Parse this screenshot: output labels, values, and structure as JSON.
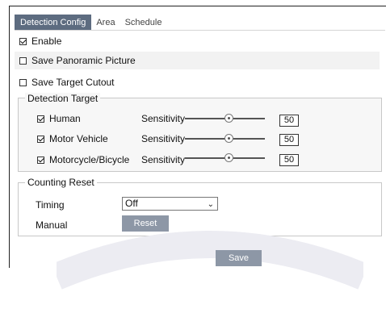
{
  "tabs": [
    {
      "label": "Detection Config",
      "active": true
    },
    {
      "label": "Area",
      "active": false
    },
    {
      "label": "Schedule",
      "active": false
    }
  ],
  "enable": {
    "label": "Enable",
    "checked": true
  },
  "save_panoramic": {
    "label": "Save Panoramic Picture",
    "checked": false
  },
  "save_target": {
    "label": "Save Target Cutout",
    "checked": false
  },
  "detection_target": {
    "title": "Detection Target",
    "items": [
      {
        "label": "Human",
        "checked": true,
        "sensitivity_label": "Sensitivity",
        "value": "50"
      },
      {
        "label": "Motor Vehicle",
        "checked": true,
        "sensitivity_label": "Sensitivity",
        "value": "50"
      },
      {
        "label": "Motorcycle/Bicycle",
        "checked": true,
        "sensitivity_label": "Sensitivity",
        "value": "50"
      }
    ]
  },
  "counting_reset": {
    "title": "Counting Reset",
    "timing_label": "Timing",
    "timing_value": "Off",
    "manual_label": "Manual",
    "reset_label": "Reset"
  },
  "save_label": "Save",
  "colors": {
    "active_tab": "#5d6c80",
    "button": "#8d97a6",
    "row_shade": "#f2f2f2"
  }
}
